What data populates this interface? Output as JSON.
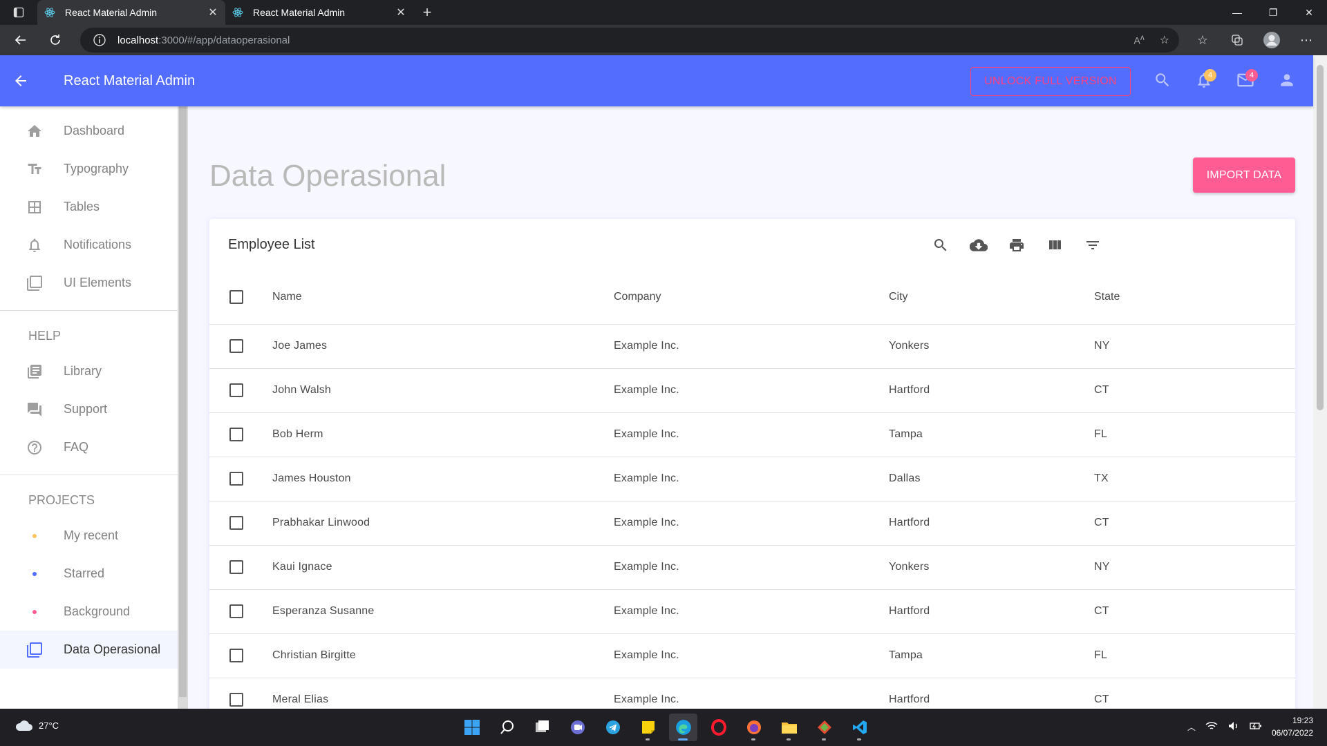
{
  "browser": {
    "tabs": [
      {
        "title": "React Material Admin",
        "active": true
      },
      {
        "title": "React Material Admin",
        "active": false
      }
    ],
    "url_host": "localhost",
    "url_path": ":3000/#/app/dataoperasional"
  },
  "header": {
    "title": "React Material Admin",
    "unlock_label": "UNLOCK FULL VERSION",
    "notifications_count": "4",
    "messages_count": "4",
    "colors": {
      "primary": "#536dfe",
      "secondary": "#ff5c93",
      "warning": "#ffc260"
    }
  },
  "sidebar": {
    "main_items": [
      {
        "label": "Dashboard",
        "icon": "home-icon"
      },
      {
        "label": "Typography",
        "icon": "text-fields-icon"
      },
      {
        "label": "Tables",
        "icon": "table-grid-icon"
      },
      {
        "label": "Notifications",
        "icon": "bell-icon"
      },
      {
        "label": "UI Elements",
        "icon": "filter-none-icon"
      }
    ],
    "help_heading": "HELP",
    "help_items": [
      {
        "label": "Library",
        "icon": "library-icon"
      },
      {
        "label": "Support",
        "icon": "forum-icon"
      },
      {
        "label": "FAQ",
        "icon": "help-circle-icon"
      }
    ],
    "projects_heading": "PROJECTS",
    "project_items": [
      {
        "label": "My recent",
        "color": "#ffc260"
      },
      {
        "label": "Starred",
        "color": "#536dfe"
      },
      {
        "label": "Background",
        "color": "#ff5c93"
      }
    ],
    "active_item": {
      "label": "Data Operasional",
      "icon": "filter-none-icon"
    }
  },
  "main": {
    "page_title": "Data Operasional",
    "import_label": "IMPORT DATA",
    "table": {
      "title": "Employee List",
      "columns": [
        "Name",
        "Company",
        "City",
        "State"
      ],
      "rows": [
        [
          "Joe James",
          "Example Inc.",
          "Yonkers",
          "NY"
        ],
        [
          "John Walsh",
          "Example Inc.",
          "Hartford",
          "CT"
        ],
        [
          "Bob Herm",
          "Example Inc.",
          "Tampa",
          "FL"
        ],
        [
          "James Houston",
          "Example Inc.",
          "Dallas",
          "TX"
        ],
        [
          "Prabhakar Linwood",
          "Example Inc.",
          "Hartford",
          "CT"
        ],
        [
          "Kaui Ignace",
          "Example Inc.",
          "Yonkers",
          "NY"
        ],
        [
          "Esperanza Susanne",
          "Example Inc.",
          "Hartford",
          "CT"
        ],
        [
          "Christian Birgitte",
          "Example Inc.",
          "Tampa",
          "FL"
        ],
        [
          "Meral Elias",
          "Example Inc.",
          "Hartford",
          "CT"
        ]
      ]
    }
  },
  "taskbar": {
    "weather": "27°C",
    "time": "19:23",
    "date": "06/07/2022"
  }
}
